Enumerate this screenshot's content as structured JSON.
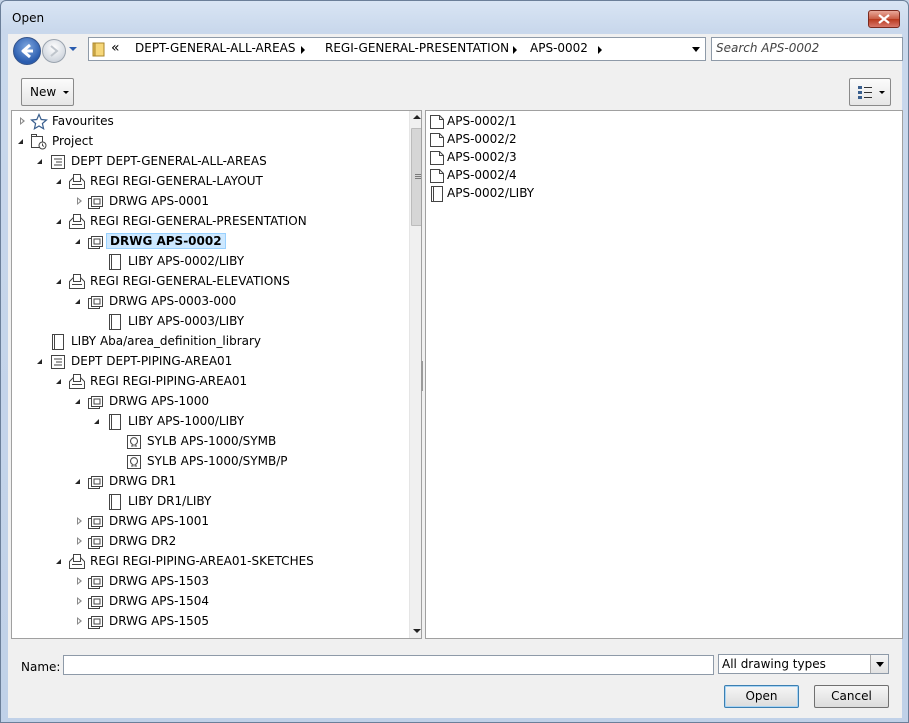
{
  "window": {
    "title": "Open"
  },
  "address": {
    "overflow": "«",
    "segments": [
      "DEPT-GENERAL-ALL-AREAS",
      "REGI-GENERAL-PRESENTATION",
      "APS-0002"
    ]
  },
  "search": {
    "placeholder": "Search APS-0002"
  },
  "toolbar": {
    "new_label": "New"
  },
  "tree": [
    {
      "label": "Favourites",
      "icon": "star-icon",
      "level": 0,
      "state": "collapsed"
    },
    {
      "label": "Project",
      "icon": "project-icon",
      "level": 0,
      "state": "expanded"
    },
    {
      "label": "DEPT DEPT-GENERAL-ALL-AREAS",
      "icon": "dept-icon",
      "level": 1,
      "state": "expanded"
    },
    {
      "label": "REGI REGI-GENERAL-LAYOUT",
      "icon": "regi-icon",
      "level": 2,
      "state": "expanded"
    },
    {
      "label": "DRWG APS-0001",
      "icon": "drwg-icon",
      "level": 3,
      "state": "collapsed"
    },
    {
      "label": "REGI REGI-GENERAL-PRESENTATION",
      "icon": "regi-icon",
      "level": 2,
      "state": "expanded"
    },
    {
      "label": "DRWG APS-0002",
      "icon": "drwg-icon",
      "level": 3,
      "state": "expanded",
      "selected": true
    },
    {
      "label": "LIBY APS-0002/LIBY",
      "icon": "liby-icon",
      "level": 4,
      "state": "none"
    },
    {
      "label": "REGI REGI-GENERAL-ELEVATIONS",
      "icon": "regi-icon",
      "level": 2,
      "state": "expanded"
    },
    {
      "label": "DRWG APS-0003-000",
      "icon": "drwg-icon",
      "level": 3,
      "state": "expanded"
    },
    {
      "label": "LIBY APS-0003/LIBY",
      "icon": "liby-icon",
      "level": 4,
      "state": "none"
    },
    {
      "label": "LIBY Aba/area_definition_library",
      "icon": "liby-icon",
      "level": 1,
      "state": "none"
    },
    {
      "label": "DEPT DEPT-PIPING-AREA01",
      "icon": "dept-icon",
      "level": 1,
      "state": "expanded"
    },
    {
      "label": "REGI REGI-PIPING-AREA01",
      "icon": "regi-icon",
      "level": 2,
      "state": "expanded"
    },
    {
      "label": "DRWG APS-1000",
      "icon": "drwg-icon",
      "level": 3,
      "state": "expanded"
    },
    {
      "label": "LIBY APS-1000/LIBY",
      "icon": "liby-icon",
      "level": 4,
      "state": "expanded"
    },
    {
      "label": "SYLB APS-1000/SYMB",
      "icon": "sylb-icon",
      "level": 5,
      "state": "none"
    },
    {
      "label": "SYLB APS-1000/SYMB/P",
      "icon": "sylb-icon",
      "level": 5,
      "state": "none"
    },
    {
      "label": "DRWG DR1",
      "icon": "drwg-icon",
      "level": 3,
      "state": "expanded"
    },
    {
      "label": "LIBY DR1/LIBY",
      "icon": "liby-icon",
      "level": 4,
      "state": "none"
    },
    {
      "label": "DRWG APS-1001",
      "icon": "drwg-icon",
      "level": 3,
      "state": "collapsed"
    },
    {
      "label": "DRWG DR2",
      "icon": "drwg-icon",
      "level": 3,
      "state": "collapsed"
    },
    {
      "label": "REGI REGI-PIPING-AREA01-SKETCHES",
      "icon": "regi-icon",
      "level": 2,
      "state": "expanded"
    },
    {
      "label": "DRWG APS-1503",
      "icon": "drwg-icon",
      "level": 3,
      "state": "collapsed"
    },
    {
      "label": "DRWG APS-1504",
      "icon": "drwg-icon",
      "level": 3,
      "state": "collapsed"
    },
    {
      "label": "DRWG APS-1505",
      "icon": "drwg-icon",
      "level": 3,
      "state": "collapsed"
    }
  ],
  "files": [
    {
      "label": "APS-0002/1",
      "icon": "sheet-icon"
    },
    {
      "label": "APS-0002/2",
      "icon": "sheet-icon"
    },
    {
      "label": "APS-0002/3",
      "icon": "sheet-icon"
    },
    {
      "label": "APS-0002/4",
      "icon": "sheet-icon"
    },
    {
      "label": "APS-0002/LIBY",
      "icon": "liby-icon"
    }
  ],
  "footer": {
    "name_label": "Name:",
    "name_value": "",
    "file_type": "All drawing types",
    "open_label": "Open",
    "cancel_label": "Cancel"
  },
  "colors": {
    "selection": "#cde8ff",
    "accent": "#2a5cae"
  }
}
